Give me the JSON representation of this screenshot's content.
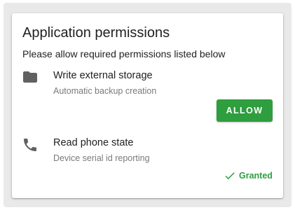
{
  "dialog": {
    "title": "Application permissions",
    "subtitle": "Please allow required permissions listed below"
  },
  "permissions": [
    {
      "icon": "folder-icon",
      "title": "Write external storage",
      "description": "Automatic backup creation",
      "action_label": "ALLOW"
    },
    {
      "icon": "phone-icon",
      "title": "Read phone state",
      "description": "Device serial id reporting",
      "status_label": "Granted"
    }
  ],
  "colors": {
    "accent": "#2e9e3e",
    "icon": "#616161",
    "text_primary": "#212121",
    "text_secondary": "#7a7a7a"
  }
}
